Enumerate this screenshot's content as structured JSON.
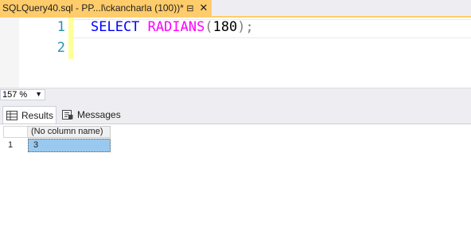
{
  "tab": {
    "title": "SQLQuery40.sql - PP...l\\ckancharla (100))*",
    "pin_glyph": "⊟",
    "close_glyph": "✕"
  },
  "editor": {
    "line_numbers": [
      "1",
      "2"
    ],
    "code": {
      "keyword": "SELECT",
      "function": "RADIANS",
      "open_paren": "(",
      "argument": "180",
      "close_paren": ")",
      "terminator": ";"
    }
  },
  "zoom": {
    "value": "157 %"
  },
  "results_tabs": [
    {
      "label": "Results",
      "icon": "grid-icon",
      "active": true
    },
    {
      "label": "Messages",
      "icon": "messages-icon",
      "active": false
    }
  ],
  "grid": {
    "columns": [
      "(No column name)"
    ],
    "rows": [
      {
        "row_number": "1",
        "cells": [
          "3"
        ]
      }
    ]
  },
  "colors": {
    "tab_accent": "#ffcc6b",
    "keyword": "#0000ff",
    "function": "#ff00ff",
    "line_number": "#2b91af",
    "selected_cell": "#99c9ef"
  }
}
